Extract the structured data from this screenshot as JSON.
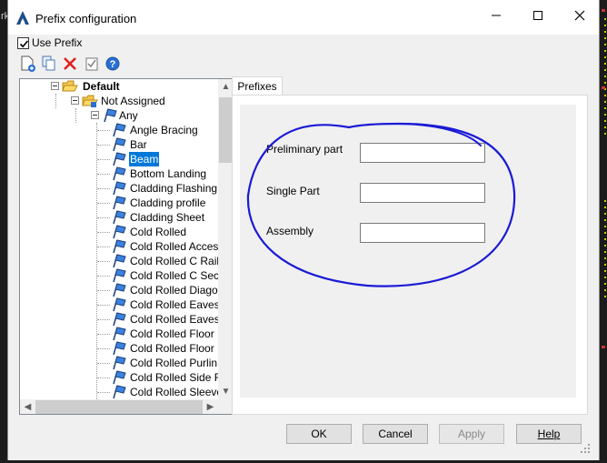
{
  "window": {
    "title": "Prefix configuration",
    "controls": [
      "minimize",
      "maximize",
      "close"
    ]
  },
  "background": {
    "left_text": "rk"
  },
  "use_prefix": {
    "label": "Use Prefix",
    "checked": true
  },
  "toolbar": {
    "icons": [
      "add-prefix-icon",
      "copy-icon",
      "delete-icon",
      "check-icon",
      "help-icon"
    ]
  },
  "tree": {
    "root": "Default",
    "not_assigned": "Not Assigned",
    "any": "Any",
    "items": [
      "Angle Bracing",
      "Bar",
      "Beam",
      "Bottom Landing",
      "Cladding Flashing",
      "Cladding profile",
      "Cladding Sheet",
      "Cold Rolled",
      "Cold Rolled Accesso",
      "Cold Rolled C Rail",
      "Cold Rolled C Sectio",
      "Cold Rolled Diagona",
      "Cold Rolled Eaves B",
      "Cold Rolled Eaves B",
      "Cold Rolled Floor Be",
      "Cold Rolled Floor Be",
      "Cold Rolled Purlin C",
      "Cold Rolled Side Ra",
      "Cold Rolled Sleeve"
    ],
    "selected": "Beam"
  },
  "tabs": {
    "active": "Prefixes"
  },
  "prefixes": {
    "preliminary_label": "Preliminary part",
    "preliminary_value": "",
    "single_label": "Single Part",
    "single_value": "",
    "assembly_label": "Assembly",
    "assembly_value": ""
  },
  "annotation": {
    "color": "#1a1ad6"
  },
  "buttons": {
    "ok": "OK",
    "cancel": "Cancel",
    "apply": "Apply",
    "help": "Help"
  }
}
